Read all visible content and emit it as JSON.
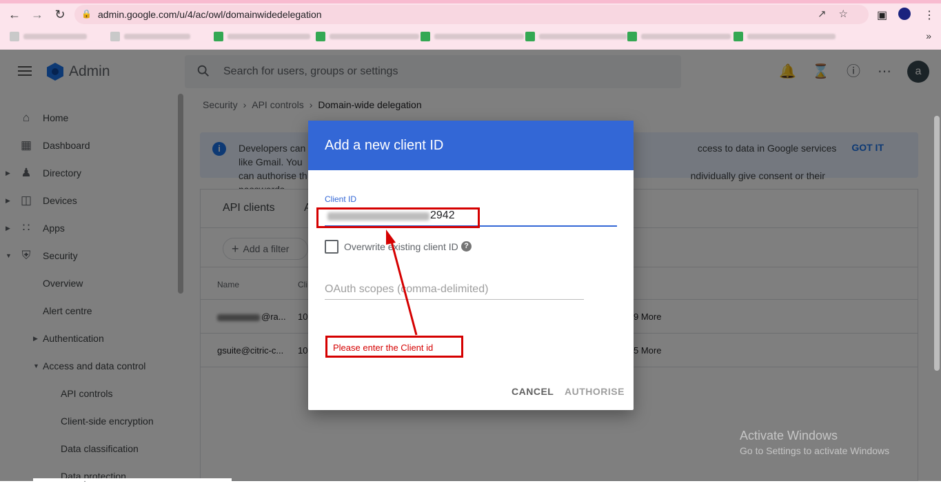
{
  "browser": {
    "url": "admin.google.com/u/4/ac/owl/domainwidedelegation",
    "bookmarks_count": 8
  },
  "app": {
    "brand": "Admin",
    "search_placeholder": "Search for users, groups or settings",
    "avatar_letter": "a"
  },
  "sidebar": {
    "items": [
      {
        "label": "Home",
        "icon": "home-icon"
      },
      {
        "label": "Dashboard",
        "icon": "dashboard-icon"
      },
      {
        "label": "Directory",
        "icon": "person-icon"
      },
      {
        "label": "Devices",
        "icon": "devices-icon"
      },
      {
        "label": "Apps",
        "icon": "apps-grid-icon"
      },
      {
        "label": "Security",
        "icon": "shield-icon"
      },
      {
        "label": "Overview"
      },
      {
        "label": "Alert centre"
      },
      {
        "label": "Authentication"
      },
      {
        "label": "Access and data control"
      },
      {
        "label": "API controls"
      },
      {
        "label": "Client-side encryption"
      },
      {
        "label": "Data classification"
      },
      {
        "label": "Data protection"
      }
    ]
  },
  "breadcrumb": {
    "items": [
      "Security",
      "API controls"
    ],
    "current": "Domain-wide delegation"
  },
  "banner": {
    "text_left_1": "Developers can r",
    "text_left_2": "can authorise th",
    "text_right_1": "ccess to data in Google services like Gmail. You",
    "text_right_2": "ndividually give consent or their passwords.",
    "action": "GOT IT"
  },
  "panel": {
    "tab_active": "API clients",
    "tab_other": "A",
    "filter_label": "Add a filter",
    "columns": [
      "Name",
      "Cli"
    ],
    "rows": [
      {
        "name_suffix": "@ra...",
        "client": "10",
        "more": "9 More"
      },
      {
        "name_suffix": "gsuite@citric-c...",
        "client": "10",
        "more": "5 More"
      }
    ]
  },
  "dialog": {
    "title": "Add a new client ID",
    "client_id_label": "Client ID",
    "client_id_value": "2942",
    "overwrite_label": "Overwrite existing client ID",
    "help": "?",
    "scopes_placeholder": "OAuth scopes (comma-delimited)",
    "cancel": "CANCEL",
    "authorise": "AUTHORISE"
  },
  "annotation": {
    "note": "Please enter the  Client id",
    "color": "#d50000"
  },
  "watermark": {
    "line1": "Activate Windows",
    "line2": "Go to Settings to activate Windows"
  }
}
